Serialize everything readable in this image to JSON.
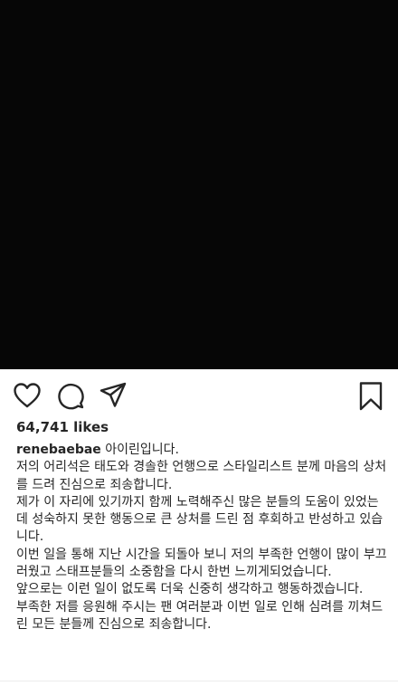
{
  "post": {
    "likes_label": "64,741 likes",
    "username": "renebaebae",
    "caption_lines": [
      "아이린입니다.",
      "저의 어리석은 태도와 경솔한 언행으로 스타일리스트 분께 마음의 상처를 드려 진심으로 죄송합니다.",
      "제가 이 자리에 있기까지 함께 노력해주신 많은 분들의 도움이 있었는데 성숙하지 못한 행동으로 큰 상처를 드린 점 후회하고 반성하고 있습니다.",
      "이번 일을 통해 지난 시간을 되돌아 보니 저의 부족한 언행이 많이 부끄러웠고 스태프분들의 소중함을 다시 한번 느끼게되었습니다.",
      "앞으로는 이런 일이 없도록 더욱 신중히 생각하고 행동하겠습니다.",
      "부족한 저를 응원해 주시는 팬 여러분과 이번 일로 인해 심려를 끼쳐드린 모든 분들께 진심으로 죄송합니다."
    ]
  },
  "icons": {
    "like": "heart-icon",
    "comment": "comment-icon",
    "share": "paper-plane-icon",
    "save": "bookmark-icon"
  },
  "colors": {
    "photo_background": "#060606",
    "text": "#262626"
  }
}
